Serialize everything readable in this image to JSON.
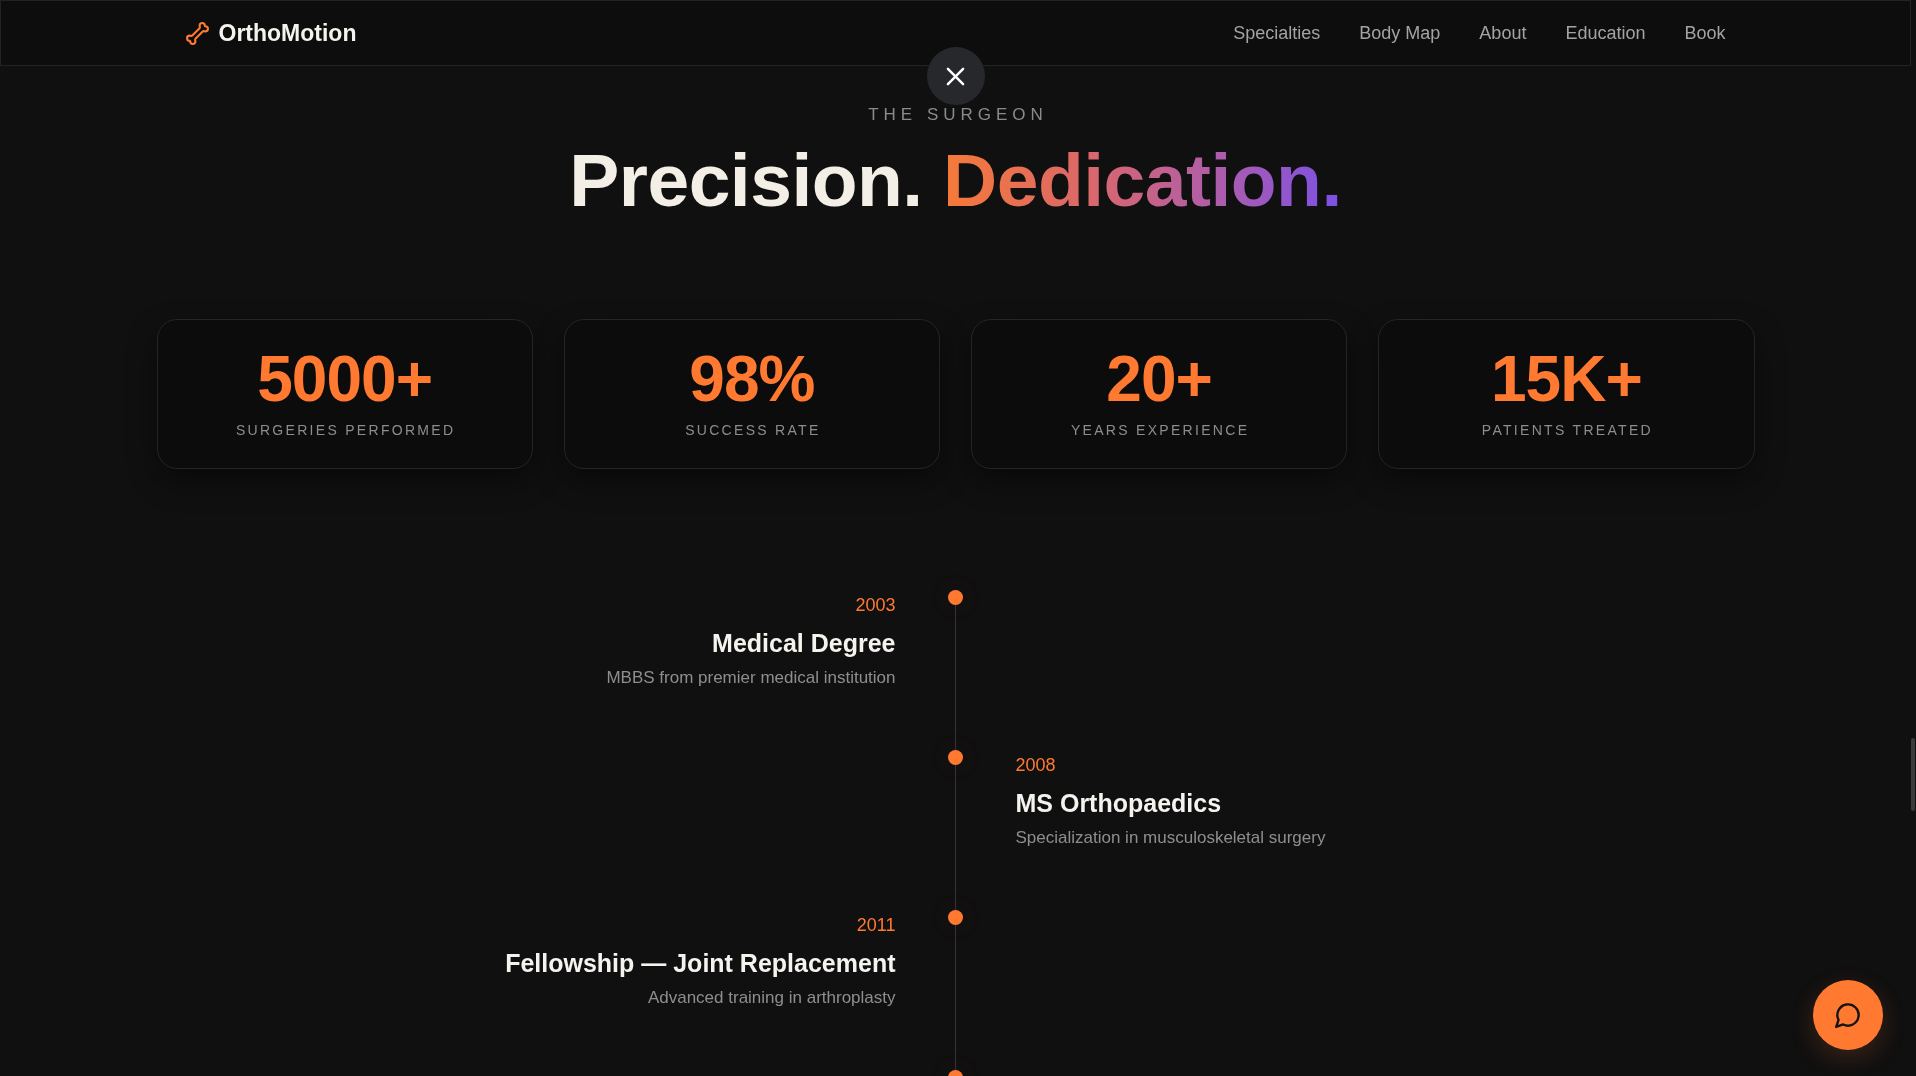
{
  "header": {
    "logo": "OrthoMotion",
    "nav": [
      "Specialties",
      "Body Map",
      "About",
      "Education",
      "Book"
    ]
  },
  "intro": {
    "eyebrow": "THE SURGEON",
    "heading": {
      "lead": "Precision.",
      "accent": "Dedication."
    }
  },
  "stats": [
    {
      "value": "5000+",
      "label": "SURGERIES PERFORMED"
    },
    {
      "value": "98%",
      "label": "SUCCESS RATE"
    },
    {
      "value": "20+",
      "label": "YEARS EXPERIENCE"
    },
    {
      "value": "15K+",
      "label": "PATIENTS TREATED"
    }
  ],
  "timeline": [
    {
      "year": "2003",
      "title": "Medical Degree",
      "description": "MBBS from premier medical institution"
    },
    {
      "year": "2008",
      "title": "MS Orthopaedics",
      "description": "Specialization in musculoskeletal surgery"
    },
    {
      "year": "2011",
      "title": "Fellowship — Joint Replacement",
      "description": "Advanced training in arthroplasty"
    }
  ]
}
